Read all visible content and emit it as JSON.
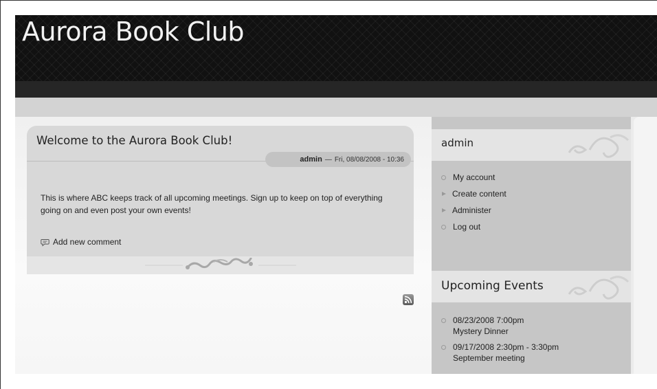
{
  "site": {
    "name": "Aurora Book Club"
  },
  "node": {
    "title": "Welcome to the Aurora Book Club!",
    "author": "admin",
    "separator": "—",
    "date": "Fri, 08/08/2008 - 10:36",
    "body": "This is where ABC keeps track of all upcoming meetings. Sign up to keep on top of everything going on and even post your own events!",
    "comment_link": "Add new comment"
  },
  "user_block": {
    "title": "admin",
    "items": [
      {
        "label": "My account",
        "bullet": "dot"
      },
      {
        "label": "Create content",
        "bullet": "triangle"
      },
      {
        "label": "Administer",
        "bullet": "triangle"
      },
      {
        "label": "Log out",
        "bullet": "dot"
      }
    ]
  },
  "events_block": {
    "title": "Upcoming Events",
    "events": [
      {
        "when": "08/23/2008 7:00pm",
        "name": "Mystery Dinner"
      },
      {
        "when": "09/17/2008 2:30pm - 3:30pm",
        "name": "September meeting"
      }
    ]
  },
  "icons": {
    "feed": "rss-feed-icon",
    "comment": "comment-bubble-icon"
  },
  "colors": {
    "header_bg": "#111111",
    "node_bg": "#d8d8d8",
    "sidebar_bg": "#c6c6c6"
  }
}
